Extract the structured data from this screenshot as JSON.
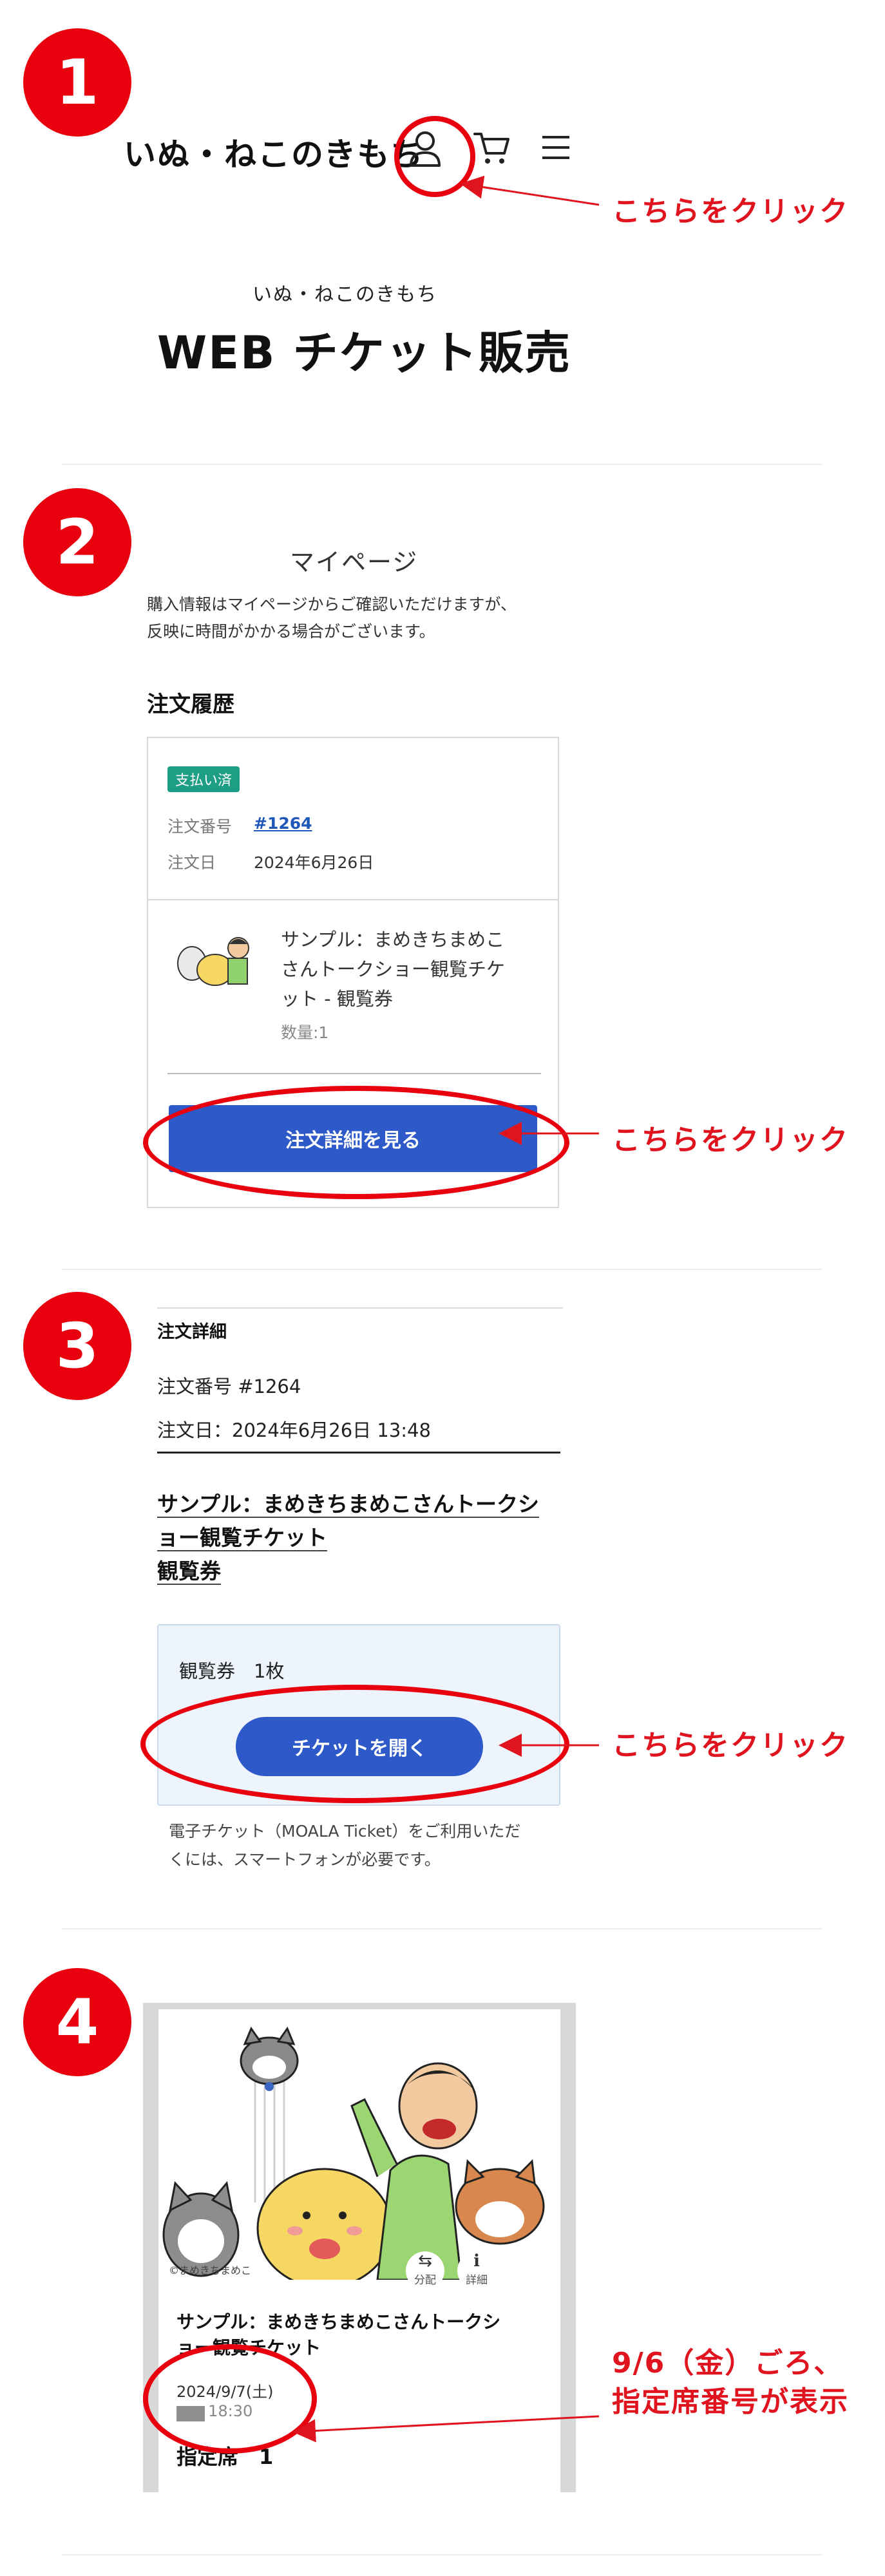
{
  "steps": [
    "1",
    "2",
    "3",
    "4"
  ],
  "step1": {
    "brand": "いぬ・ねこのきもち",
    "sub_brand": "いぬ・ねこのきもち",
    "title": "WEB チケット販売",
    "callout": "こちらをクリック"
  },
  "step2": {
    "mypage_title": "マイページ",
    "info_line1": "購入情報はマイページからご確認いただけますが、",
    "info_line2": "反映に時間がかかる場合がございます。",
    "order_history": "注文履歴",
    "badge": "支払い済",
    "order_no_label": "注文番号",
    "order_no": "#1264",
    "order_date_label": "注文日",
    "order_date": "2024年6月26日",
    "product_line1": "サンプル：まめきちまめこ",
    "product_line2": "さんトークショー観覧チケ",
    "product_line3": "ット - 観覧券",
    "quantity": "数量:1",
    "button": "注文詳細を見る",
    "callout": "こちらをクリック"
  },
  "step3": {
    "heading": "注文詳細",
    "order_no": "注文番号 #1264",
    "order_date": "注文日：2024年6月26日 13:48",
    "product_line1": "サンプル：まめきちまめこさんトークシ",
    "product_line2": "ョー観覧チケット",
    "product_line3": "観覧券",
    "ticket_line": "観覧券　1枚",
    "button": "チケットを開く",
    "note_line1": "電子チケット（MOALA Ticket）をご利用いただ",
    "note_line2": "くには、スマートフォンが必要です。",
    "callout": "こちらをクリック"
  },
  "step4": {
    "icon1_label": "分配",
    "icon2_label": "詳細",
    "copyright": "©まめきちまめこ",
    "ticket_title_line1": "サンプル：まめきちまめこさんトークシ",
    "ticket_title_line2": "ョー観覧チケット",
    "date": "2024/9/7(土)",
    "time": "18:30",
    "seat": "指定席　1",
    "callout_line1": "9/6（金）ごろ、",
    "callout_line2": "指定席番号が表示"
  },
  "colors": {
    "accent_red": "#e8000f",
    "button_blue": "#2d5ac8",
    "badge_green": "#1e9e84"
  },
  "icons": [
    "user-icon",
    "cart-icon",
    "hamburger-menu-icon",
    "share-icon",
    "info-icon"
  ]
}
